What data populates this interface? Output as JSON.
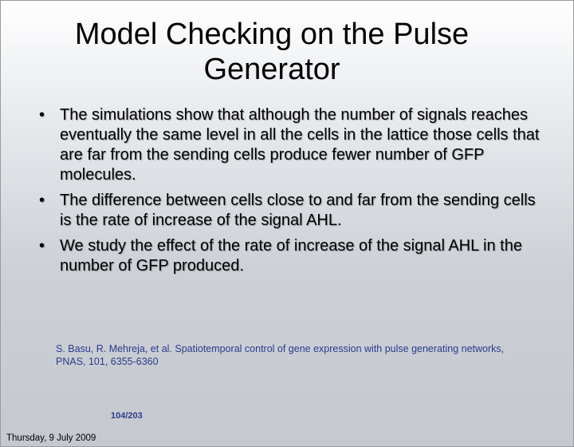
{
  "slide": {
    "title": "Model Checking on the Pulse Generator",
    "bullets": [
      "The simulations show that although the number of signals reaches eventually the same level in all the cells in the lattice those cells that are far from the sending cells produce fewer number of GFP molecules.",
      "The difference between cells close to and far from the sending cells is the rate of increase of the signal AHL.",
      "We study the effect of the rate of increase of the signal AHL in the number of GFP produced."
    ],
    "bullet_symbol": "•",
    "reference": "S. Basu, R. Mehreja, et al. Spatiotemporal control of gene expression with pulse generating networks, PNAS, 101, 6355-6360",
    "page_number": "104/203",
    "footer_date": "Thursday, 9 July 2009"
  }
}
